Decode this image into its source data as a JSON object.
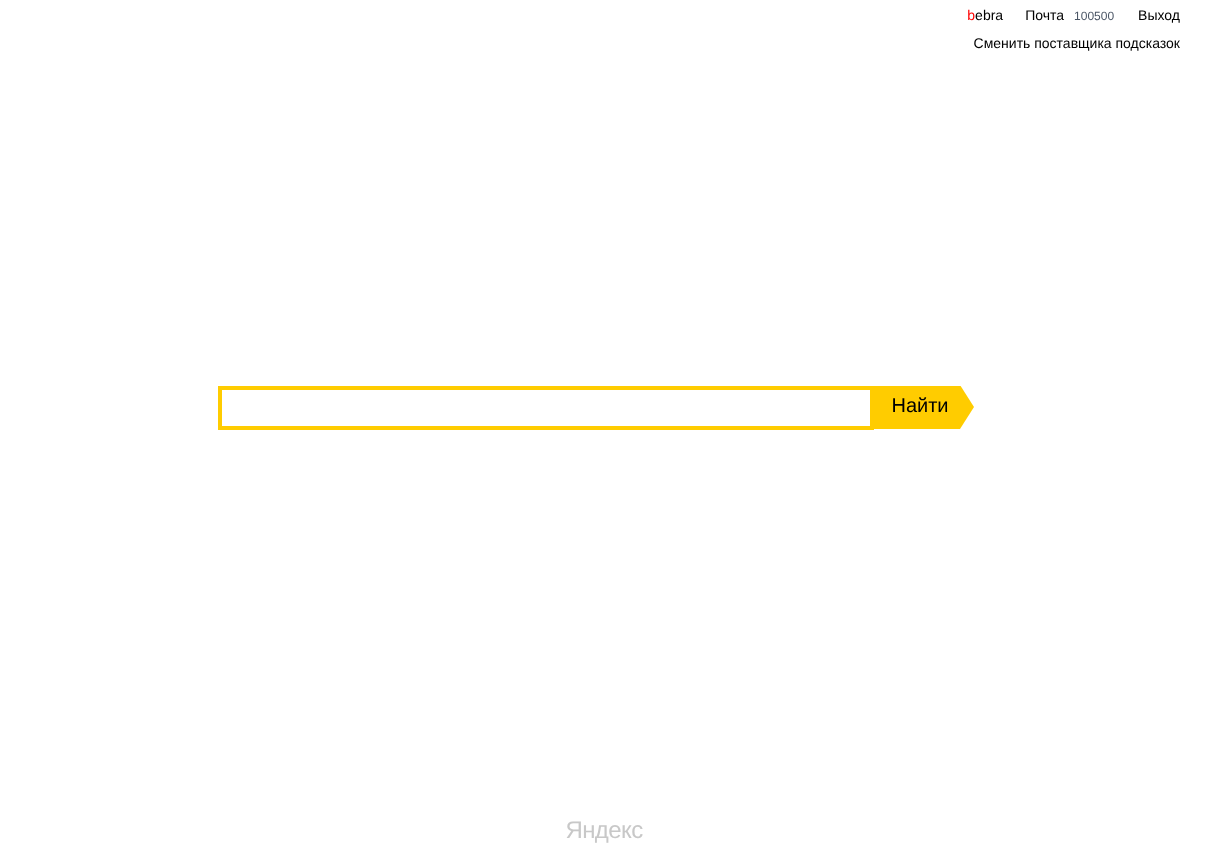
{
  "header": {
    "user": {
      "initial": "b",
      "rest": "ebra"
    },
    "mail": {
      "label": "Почта",
      "count": "100500"
    },
    "logout": "Выход",
    "change_provider": "Сменить поставщика подсказок"
  },
  "search": {
    "button": "Найти"
  },
  "footer": {
    "logo": "Яндекс"
  }
}
